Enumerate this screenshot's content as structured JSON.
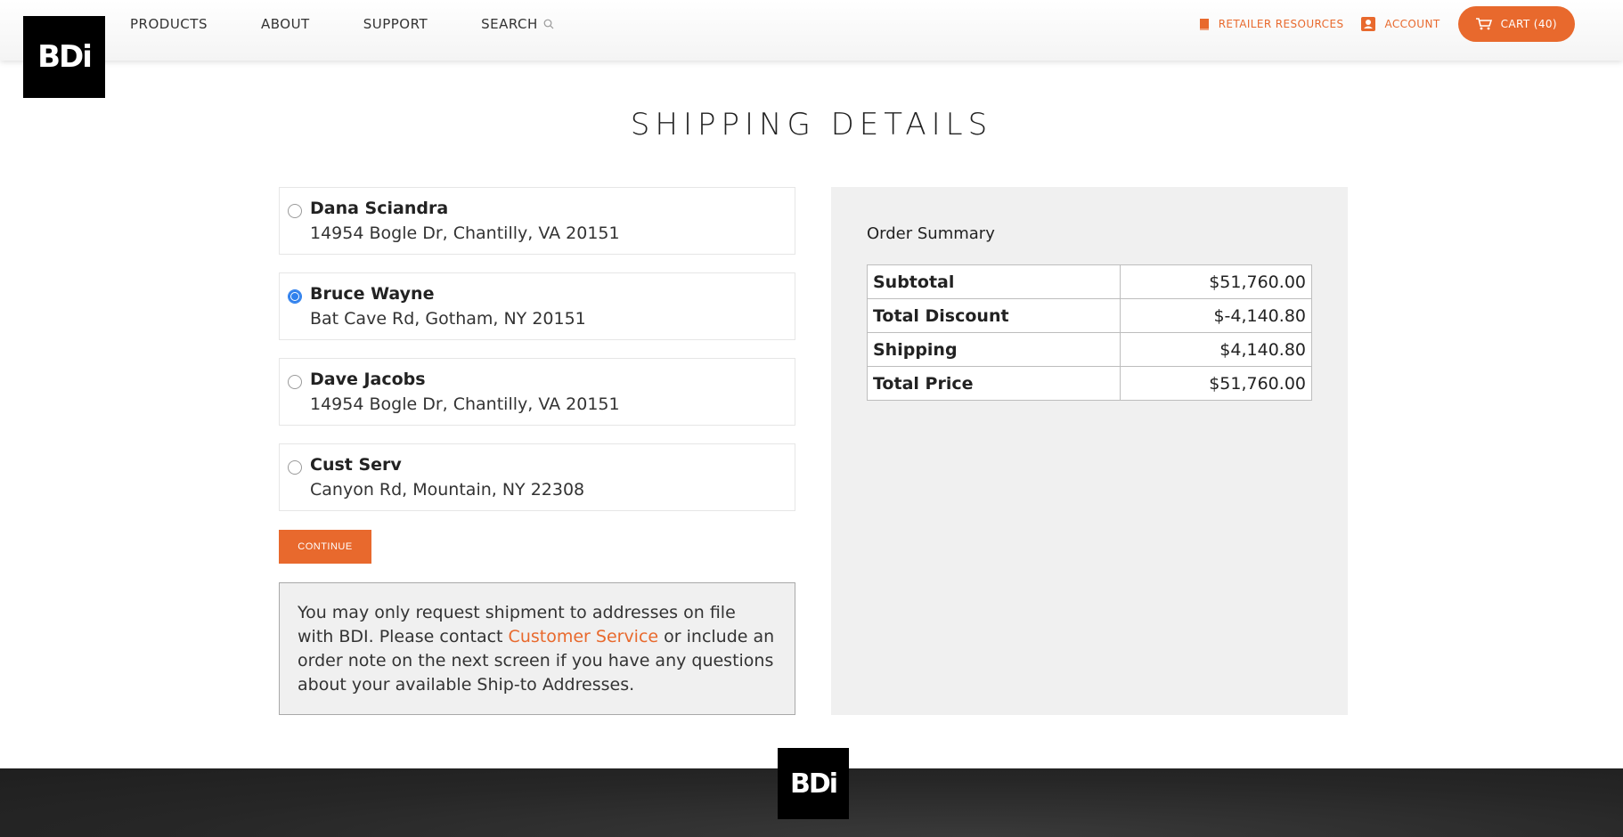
{
  "header": {
    "logo_text": "BDi",
    "nav": [
      "PRODUCTS",
      "ABOUT",
      "SUPPORT",
      "SEARCH"
    ],
    "retailer_resources": "RETAILER RESOURCES",
    "account": "ACCOUNT",
    "cart": "CART (40)"
  },
  "page": {
    "title": "SHIPPING DETAILS"
  },
  "addresses": [
    {
      "name": "Dana Sciandra",
      "address": "14954 Bogle Dr, Chantilly, VA 20151",
      "selected": false
    },
    {
      "name": "Bruce Wayne",
      "address": "Bat Cave Rd, Gotham, NY 20151",
      "selected": true
    },
    {
      "name": "Dave Jacobs",
      "address": "14954 Bogle Dr, Chantilly, VA 20151",
      "selected": false
    },
    {
      "name": "Cust Serv",
      "address": "Canyon Rd, Mountain, NY 22308",
      "selected": false
    }
  ],
  "continue_label": "CONTINUE",
  "notice": {
    "before": "You may only request shipment to addresses on file with BDI. Please contact ",
    "link": "Customer Service",
    "after": " or include an order note on the next screen if you have any questions about your available Ship-to Addresses."
  },
  "summary": {
    "title": "Order Summary",
    "rows": [
      {
        "label": "Subtotal",
        "value": "$51,760.00"
      },
      {
        "label": "Total Discount",
        "value": "$-4,140.80"
      },
      {
        "label": "Shipping",
        "value": "$4,140.80"
      },
      {
        "label": "Total Price",
        "value": "$51,760.00"
      }
    ]
  },
  "footer": {
    "logo_text": "BDi"
  },
  "colors": {
    "accent": "#e8692d",
    "radio_selected": "#2f80ed",
    "panel_bg": "#f0f0f0",
    "footer_bg": "#262626"
  }
}
